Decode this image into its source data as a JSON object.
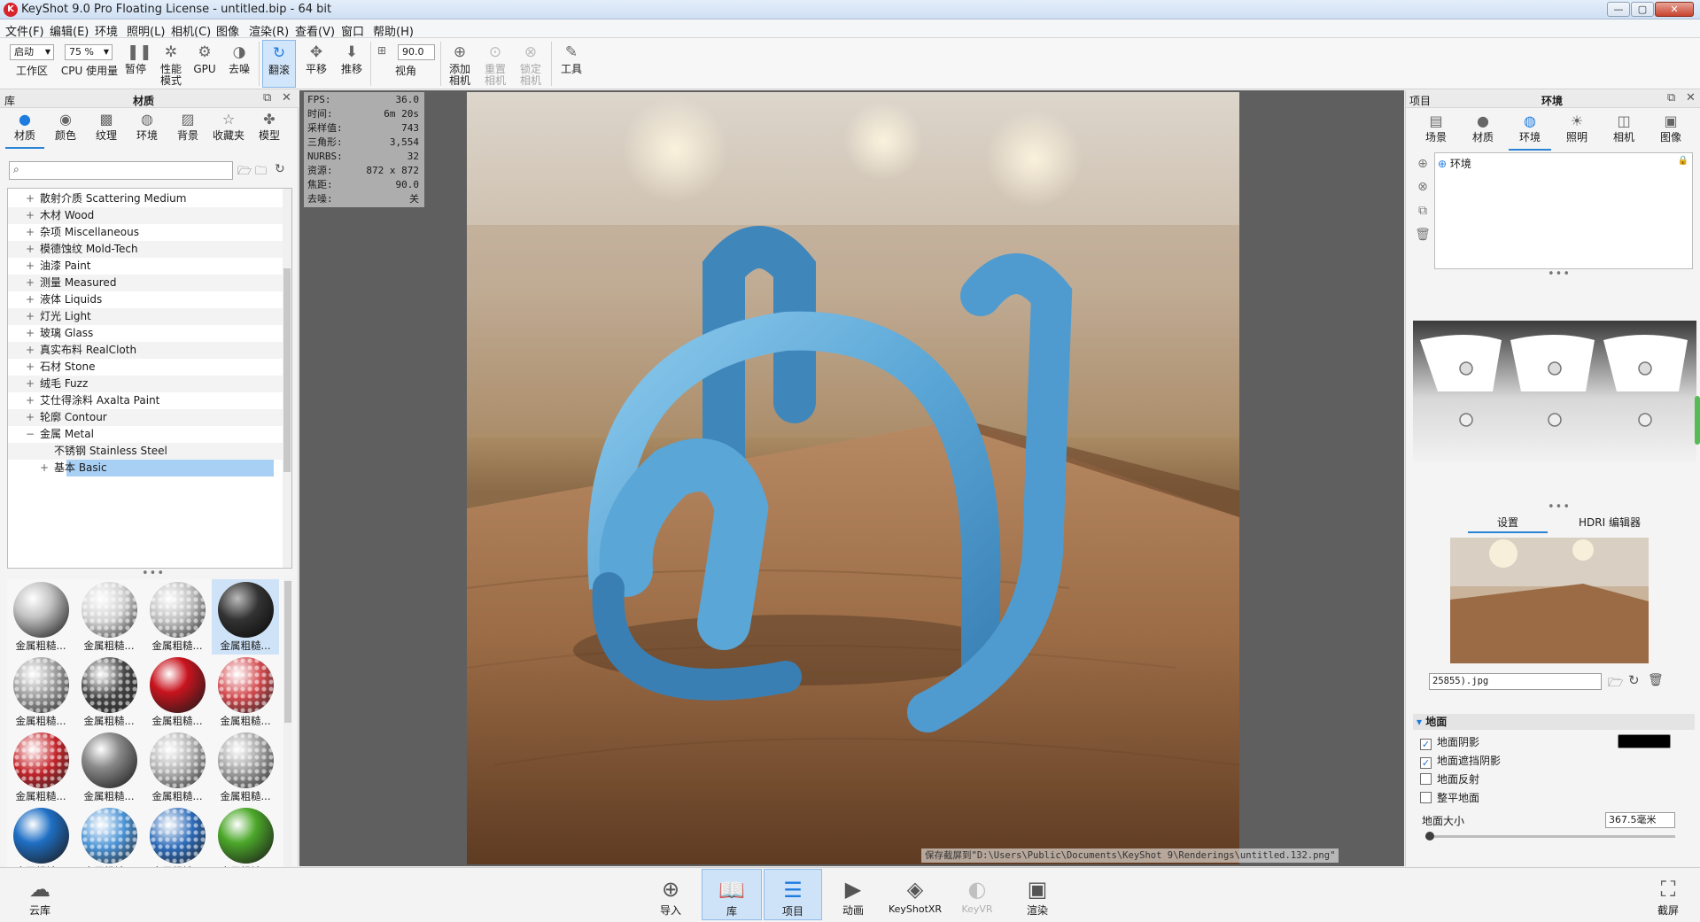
{
  "window": {
    "title": "KeyShot 9.0 Pro Floating License  - untitled.bip  - 64 bit",
    "icon": "keyshot-logo-icon"
  },
  "menu": [
    "文件(F)",
    "编辑(E)",
    "环境",
    "照明(L)",
    "相机(C)",
    "图像",
    "渲染(R)",
    "查看(V)",
    "窗口",
    "帮助(H)"
  ],
  "toolbar": {
    "workspace_value": "启动",
    "workspace_label": "工作区",
    "cpu_value": "75 %",
    "cpu_label": "CPU 使用量",
    "pause": "暂停",
    "perf_line1": "性能",
    "perf_line2": "模式",
    "gpu": "GPU",
    "denoise": "去噪",
    "tumble": "翻滚",
    "pan": "平移",
    "dolly": "推移",
    "fov_value": "90.0",
    "fov_label": "视角",
    "add_cam_1": "添加",
    "add_cam_2": "相机",
    "reset_cam_1": "重置",
    "reset_cam_2": "相机",
    "lock_cam_1": "锁定",
    "lock_cam_2": "相机",
    "tools": "工具"
  },
  "library": {
    "header_left": "库",
    "header_title": "材质",
    "tabs": [
      {
        "label": "材质",
        "icon": "material-icon"
      },
      {
        "label": "颜色",
        "icon": "color-icon"
      },
      {
        "label": "纹理",
        "icon": "texture-icon"
      },
      {
        "label": "环境",
        "icon": "environment-icon"
      },
      {
        "label": "背景",
        "icon": "background-icon"
      },
      {
        "label": "收藏夹",
        "icon": "favorites-icon"
      },
      {
        "label": "模型",
        "icon": "model-icon"
      }
    ],
    "tree": [
      {
        "label": "散射介质 Scattering Medium",
        "indent": 0,
        "expanded": false
      },
      {
        "label": "木材 Wood",
        "indent": 0,
        "expanded": false
      },
      {
        "label": "杂项 Miscellaneous",
        "indent": 0,
        "expanded": false
      },
      {
        "label": "模德蚀纹 Mold-Tech",
        "indent": 0,
        "expanded": false
      },
      {
        "label": "油漆 Paint",
        "indent": 0,
        "expanded": false
      },
      {
        "label": "测量 Measured",
        "indent": 0,
        "expanded": false
      },
      {
        "label": "液体 Liquids",
        "indent": 0,
        "expanded": false
      },
      {
        "label": "灯光 Light",
        "indent": 0,
        "expanded": false
      },
      {
        "label": "玻璃 Glass",
        "indent": 0,
        "expanded": false
      },
      {
        "label": "真实布料 RealCloth",
        "indent": 0,
        "expanded": false
      },
      {
        "label": "石材 Stone",
        "indent": 0,
        "expanded": false
      },
      {
        "label": "绒毛 Fuzz",
        "indent": 0,
        "expanded": false
      },
      {
        "label": "艾仕得涂料 Axalta Paint",
        "indent": 0,
        "expanded": false
      },
      {
        "label": "轮廓 Contour",
        "indent": 0,
        "expanded": false
      },
      {
        "label": "金属 Metal",
        "indent": 0,
        "expanded": true
      },
      {
        "label": "不锈钢 Stainless Steel",
        "indent": 1,
        "expanded": false
      },
      {
        "label": "基本 Basic",
        "indent": 1,
        "expanded": false,
        "selected": true
      }
    ],
    "tiles": [
      {
        "label": "金属粗糙...",
        "color": "#c4c4c4",
        "style": "chrome"
      },
      {
        "label": "金属粗糙...",
        "color": "#d0d0d0",
        "style": "mesh"
      },
      {
        "label": "金属粗糙...",
        "color": "#bcbcbc",
        "style": "mesh"
      },
      {
        "label": "金属粗糙...",
        "color": "#2a2a2a",
        "style": "dark",
        "selected": true
      },
      {
        "label": "金属粗糙...",
        "color": "#9a9a9a",
        "style": "mesh"
      },
      {
        "label": "金属粗糙...",
        "color": "#444444",
        "style": "mesh"
      },
      {
        "label": "金属粗糙...",
        "color": "#c8141e",
        "style": "chrome"
      },
      {
        "label": "金属粗糙...",
        "color": "#d24a4e",
        "style": "mesh"
      },
      {
        "label": "金属粗糙...",
        "color": "#c3242a",
        "style": "mesh"
      },
      {
        "label": "金属粗糙...",
        "color": "#8a8a8a",
        "style": "chrome"
      },
      {
        "label": "金属粗糙...",
        "color": "#b0b0b0",
        "style": "mesh"
      },
      {
        "label": "金属粗糙...",
        "color": "#9e9e9e",
        "style": "mesh"
      },
      {
        "label": "金属粗糙...",
        "color": "#1f6fc4",
        "style": "chrome"
      },
      {
        "label": "金属粗糙...",
        "color": "#4a92d4",
        "style": "mesh"
      },
      {
        "label": "金属粗糙...",
        "color": "#2c6ab8",
        "style": "mesh"
      },
      {
        "label": "金属粗糙...",
        "color": "#4ca82a",
        "style": "chrome"
      },
      {
        "label": "",
        "color": "#6fc038",
        "style": "mesh"
      },
      {
        "label": "",
        "color": "#52b02e",
        "style": "mesh"
      },
      {
        "label": "",
        "color": "#bdbdbd",
        "style": "chrome"
      },
      {
        "label": "",
        "color": "#a8a8a8",
        "style": "chrome"
      }
    ]
  },
  "stats": [
    {
      "k": "FPS:",
      "v": "36.0"
    },
    {
      "k": "时间:",
      "v": "6m 20s"
    },
    {
      "k": "采样值:",
      "v": "743"
    },
    {
      "k": "三角形:",
      "v": "3,554"
    },
    {
      "k": "NURBS:",
      "v": "32"
    },
    {
      "k": "资源:",
      "v": "872 x 872"
    },
    {
      "k": "焦距:",
      "v": "90.0"
    },
    {
      "k": "去噪:",
      "v": "关"
    }
  ],
  "save_message": "保存截屏到\"D:\\Users\\Public\\Documents\\KeyShot 9\\Renderings\\untitled.132.png\"",
  "project": {
    "header_left": "项目",
    "header_title": "环境",
    "tabs": [
      {
        "label": "场景",
        "icon": "scene-icon"
      },
      {
        "label": "材质",
        "icon": "material-icon"
      },
      {
        "label": "环境",
        "icon": "environment-icon"
      },
      {
        "label": "照明",
        "icon": "lighting-icon"
      },
      {
        "label": "相机",
        "icon": "camera-icon"
      },
      {
        "label": "图像",
        "icon": "image-icon"
      }
    ],
    "env_item": "环境",
    "subtab_settings": "设置",
    "subtab_hdri": "HDRI 编辑器",
    "hdri_file": "25855).jpg",
    "ground_section": "地面",
    "ground_shadow": "地面阴影",
    "ground_occlusion": "地面遮挡阴影",
    "ground_reflection": "地面反射",
    "flatten_ground": "整平地面",
    "ground_size_label": "地面大小",
    "ground_size_value": "367.5毫米",
    "shadow_color": "#000000"
  },
  "footer": {
    "cloud": "云库",
    "import": "导入",
    "library": "库",
    "project": "项目",
    "animation": "动画",
    "keyshotxr": "KeyShotXR",
    "keyvr": "KeyVR",
    "render": "渲染",
    "screenshot": "截屏"
  },
  "colors": {
    "accent": "#1e7be0",
    "selection": "#a8d0f5",
    "object_blue": "#5aa6d6"
  }
}
